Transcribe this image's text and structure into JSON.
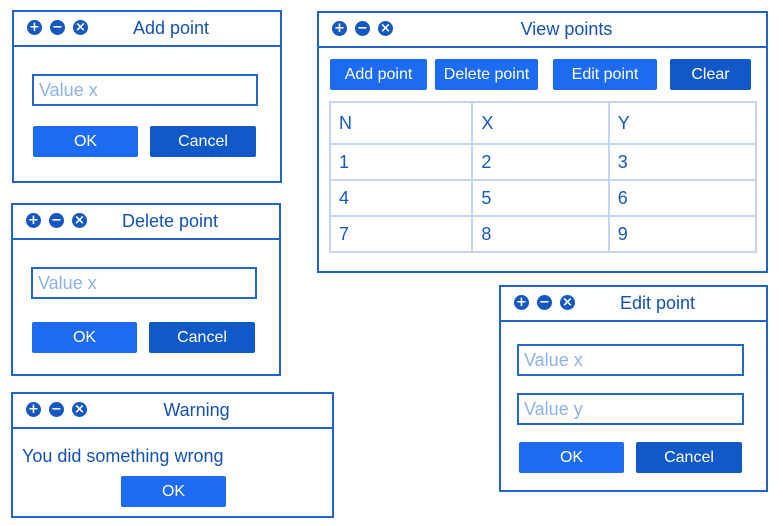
{
  "add_dialog": {
    "title": "Add point",
    "input_x_placeholder": "Value x",
    "ok_label": "OK",
    "cancel_label": "Cancel"
  },
  "delete_dialog": {
    "title": "Delete point",
    "input_x_placeholder": "Value x",
    "ok_label": "OK",
    "cancel_label": "Cancel"
  },
  "warning_dialog": {
    "title": "Warning",
    "message": "You did something wrong",
    "ok_label": "OK"
  },
  "view_dialog": {
    "title": "View points",
    "toolbar": {
      "add_label": "Add point",
      "delete_label": "Delete point",
      "edit_label": "Edit point",
      "clear_label": "Clear"
    },
    "table": {
      "headers": [
        "N",
        "X",
        "Y"
      ],
      "rows": [
        [
          "1",
          "2",
          "3"
        ],
        [
          "4",
          "5",
          "6"
        ],
        [
          "7",
          "8",
          "9"
        ]
      ]
    }
  },
  "edit_dialog": {
    "title": "Edit point",
    "input_x_placeholder": "Value x",
    "input_y_placeholder": "Value y",
    "ok_label": "OK",
    "cancel_label": "Cancel"
  },
  "window_controls": {
    "maximize": "+",
    "minimize": "−",
    "close": "×"
  },
  "colors": {
    "border": "#1f63cf",
    "primary_button": "#1c6bf0",
    "secondary_button": "#1158c9",
    "placeholder": "#8eb1e8",
    "table_grid": "#c4d5f1"
  }
}
